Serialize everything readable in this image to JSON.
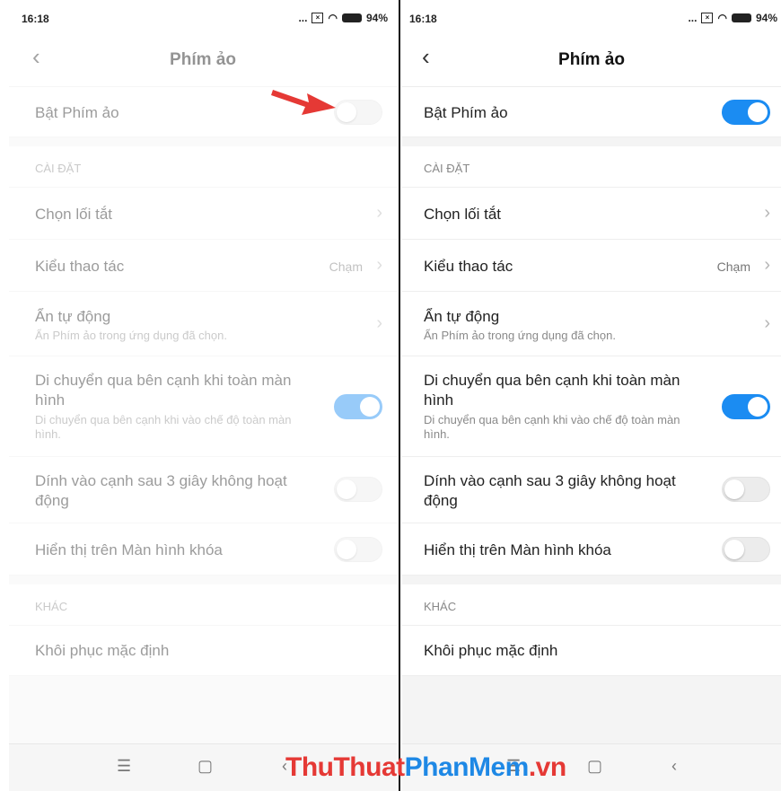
{
  "status": {
    "time": "16:18",
    "dots": "...",
    "battery": "94%"
  },
  "title": "Phím ảo",
  "master_toggle_label": "Bật Phím ảo",
  "sections": {
    "settings": "CÀI ĐẶT",
    "other": "KHÁC"
  },
  "items": {
    "shortcut": "Chọn lối tắt",
    "action_type": {
      "label": "Kiểu thao tác",
      "value": "Chạm"
    },
    "auto_hide": {
      "label": "Ẩn tự động",
      "sub": "Ẩn Phím ảo trong ứng dụng đã chọn."
    },
    "move_side": {
      "label": "Di chuyển qua bên cạnh khi toàn màn hình",
      "sub": "Di chuyển qua bên cạnh khi vào chế độ toàn màn hình."
    },
    "stick_edge": "Dính vào cạnh sau 3 giây không hoạt động",
    "lock_screen": "Hiển thị trên Màn hình khóa",
    "reset": "Khôi phục mặc định"
  },
  "left_state": {
    "master": false,
    "move_side": true,
    "stick_edge": false,
    "lock_screen": false
  },
  "right_state": {
    "master": true,
    "move_side": true,
    "stick_edge": false,
    "lock_screen": false
  },
  "colors": {
    "toggle_on": "#1b8cf2",
    "arrow": "#e53935"
  },
  "watermark": {
    "part1": "ThuThuat",
    "part2": "PhanMem",
    "part3": ".vn"
  }
}
